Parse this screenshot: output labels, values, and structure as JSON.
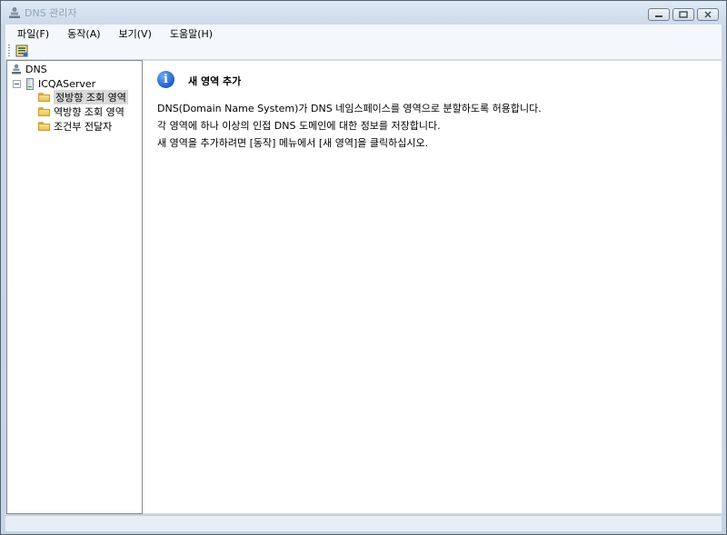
{
  "window": {
    "title": "DNS 관리자"
  },
  "menu": [
    {
      "label": "파일(F)"
    },
    {
      "label": "동작(A)"
    },
    {
      "label": "보기(V)"
    },
    {
      "label": "도움말(H)"
    }
  ],
  "tree": {
    "root": "DNS",
    "server": "ICQAServer",
    "children": [
      {
        "label": "정방향 조회 영역",
        "selected": true
      },
      {
        "label": "역방향 조회 영역"
      },
      {
        "label": "조건부 전달자"
      }
    ]
  },
  "panel": {
    "heading": "새 영역 추가",
    "lines": [
      "DNS(Domain Name System)가 DNS 네임스페이스를 영역으로 분할하도록 허용합니다.",
      "각 영역에 하나 이상의 인접 DNS 도메인에 대한 정보를 저장합니다.",
      "새 영역을 추가하려면 [동작] 메뉴에서 [새 영역]을 클릭하십시오."
    ]
  }
}
